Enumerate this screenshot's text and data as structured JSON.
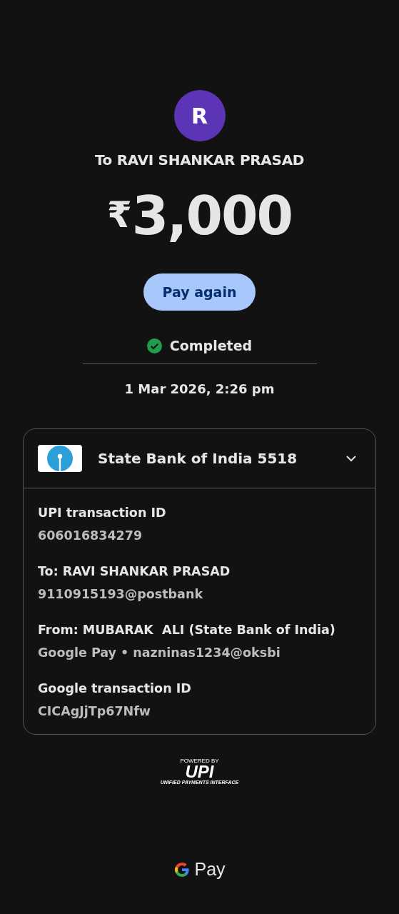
{
  "recipient": {
    "initial": "R",
    "title": "To RAVI SHANKAR PRASAD"
  },
  "amount": {
    "currency": "₹",
    "value": "3,000"
  },
  "pay_again_button": "Pay again",
  "status": {
    "label": "Completed"
  },
  "date_time": "1 Mar 2026, 2:26 pm",
  "details_card": {
    "bank": "State Bank of India 5518",
    "rows": [
      {
        "label": "UPI transaction ID",
        "value": "606016834279"
      },
      {
        "label": "To: RAVI SHANKAR PRASAD",
        "value": "9110915193@postbank"
      },
      {
        "label": "From: MUBARAK  ALI (State Bank of India)",
        "value": "Google Pay • nazninas1234@oksbi"
      },
      {
        "label": "Google transaction ID",
        "value": "CICAgJjTp67Nfw"
      }
    ]
  },
  "upi_badge": {
    "top": "POWERED BY",
    "logo": "UPI",
    "bottom": "UNIFIED PAYMENTS INTERFACE"
  },
  "footer": {
    "brand": "Pay"
  }
}
